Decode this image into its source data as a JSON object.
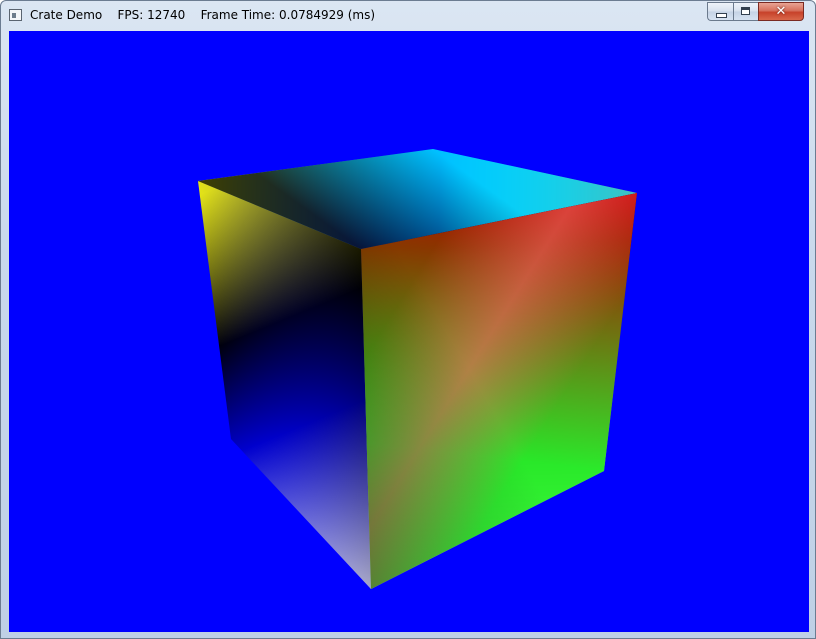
{
  "window": {
    "title": "Crate Demo",
    "fps_label": "FPS: 12740",
    "frame_time_label": "Frame Time: 0.0784929 (ms)",
    "title_separator": "    "
  },
  "controls": {
    "minimize_icon": "minimize-icon",
    "maximize_icon": "maximize-icon",
    "close_icon": "close-icon",
    "close_glyph": "✕"
  },
  "viewport": {
    "clear_color": "#0000ff",
    "scene": "vertex-colored cube",
    "vertex_colors": [
      "#ffff00",
      "#00ffff",
      "#ff0000",
      "#000000",
      "#ffffff",
      "#00ff00",
      "#0000ff"
    ]
  }
}
